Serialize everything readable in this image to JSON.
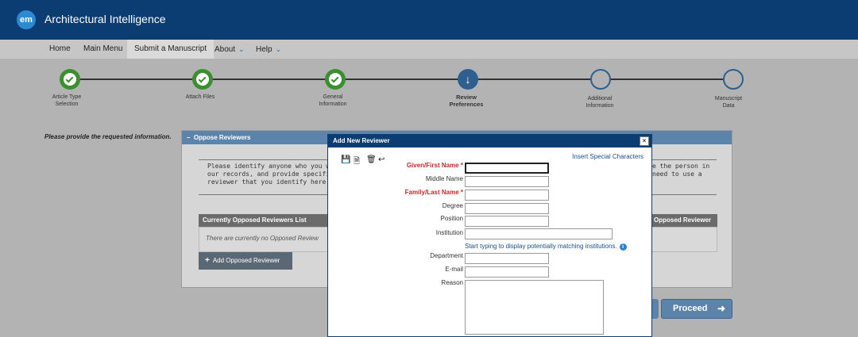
{
  "app": {
    "logo_text": "em",
    "title": "Architectural Intelligence"
  },
  "nav": {
    "items": [
      "Home",
      "Main Menu",
      "Submit a Manuscript",
      "About",
      "Help"
    ],
    "chevron_glyph": "⌄"
  },
  "steps": [
    {
      "label": "Article Type\nSelection",
      "state": "done"
    },
    {
      "label": "Attach Files",
      "state": "done"
    },
    {
      "label": "General\nInformation",
      "state": "done"
    },
    {
      "label": "Review\nPreferences",
      "state": "current"
    },
    {
      "label": "Additional\nInformation",
      "state": "todo"
    },
    {
      "label": "Manuscript\nData",
      "state": "todo"
    }
  ],
  "instructions": "Please provide the requested information.",
  "panel": {
    "title": "Oppose Reviewers",
    "collapse_glyph": "–",
    "text_left": "Please identify anyone who you would\nour records, and provide specific reaso\nreviewer that you identify here, but wi",
    "text_right": "e the person in\nneed to use a",
    "list_header_left": "Currently Opposed Reviewers List",
    "list_header_right": "Opposed Reviewer",
    "empty_text": "There are currently no Opposed Review",
    "add_button": "Add Opposed Reviewer",
    "add_glyph": "+"
  },
  "proceed": {
    "label": "Proceed",
    "arrow": "➜"
  },
  "modal": {
    "title": "Add New Reviewer",
    "close_glyph": "×",
    "special_link": "Insert Special Characters",
    "toolbar": [
      "💾",
      "🗎",
      "🗑",
      "↩"
    ],
    "required_mark": "*",
    "fields": {
      "given": "Given/First Name",
      "middle": "Middle Name",
      "family": "Family/Last Name",
      "degree": "Degree",
      "position": "Position",
      "institution": "Institution",
      "department": "Department",
      "email": "E-mail",
      "reason": "Reason"
    },
    "institution_hint": "Start typing to display potentially matching institutions.",
    "info_glyph": "i"
  },
  "colors": {
    "header": "#0b3d73",
    "done": "#3a8f2e",
    "current": "#2f5f8f",
    "required": "#c3272b",
    "link": "#1a4d8c"
  }
}
